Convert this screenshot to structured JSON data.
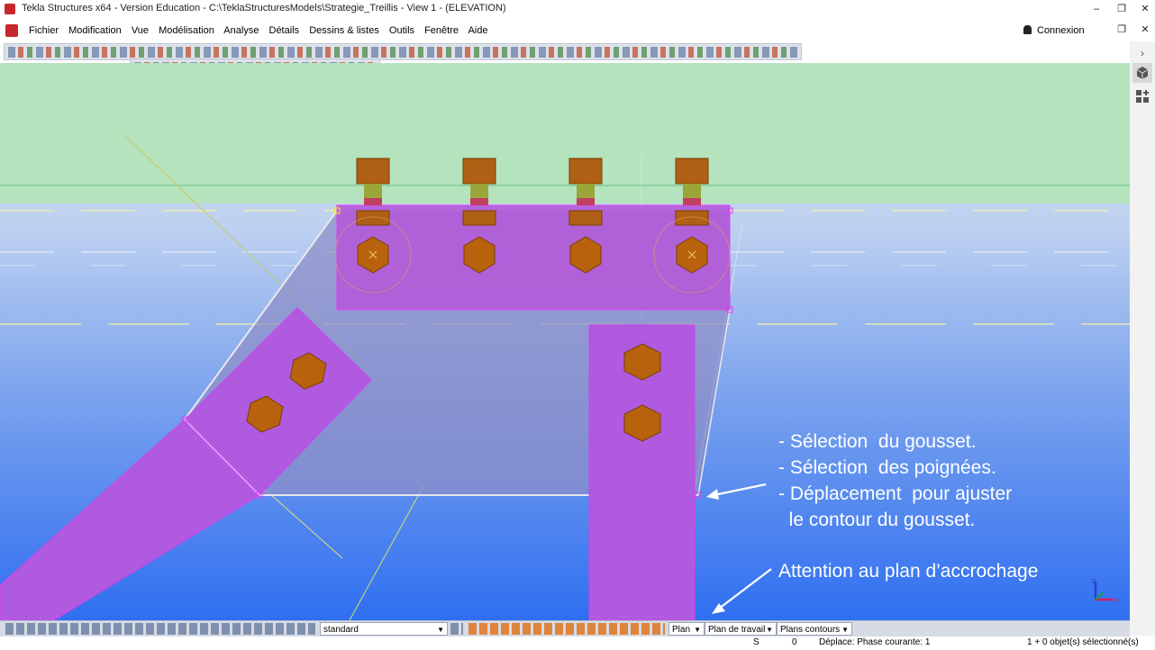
{
  "window": {
    "title": "Tekla Structures x64 - Version Education - C:\\TeklaStructuresModels\\Strategie_Treillis  - View 1 - (ELEVATION)",
    "minimize": "–",
    "maximize": "❐",
    "close": "✕"
  },
  "menu": {
    "items": [
      "Fichier",
      "Modification",
      "Vue",
      "Modélisation",
      "Analyse",
      "Détails",
      "Dessins & listes",
      "Outils",
      "Fenêtre",
      "Aide"
    ],
    "connexion": "Connexion",
    "restore": "❐",
    "close": "✕"
  },
  "sidepanel": {
    "expand": "›",
    "model_icon": "cube-icon",
    "components_icon": "components-icon"
  },
  "annotations": {
    "steps": "- Sélection  du gousset.\n- Sélection  des poignées.\n- Déplacement  pour ajuster\n  le contour du gousset.",
    "warning": "Attention au plan d’accrochage"
  },
  "statusbar": {
    "filter": "standard",
    "plane_mode": "Plan",
    "work_plane": "Plan de travail",
    "contour_planes": "Plans contours"
  },
  "bottombar": {
    "snap_key": "S",
    "count": "0",
    "message": "Déplace: Phase courante: 1",
    "selection": "1 + 0 objet(s) sélectionné(s)"
  },
  "colors": {
    "plate": "#b05ae0",
    "gusset": "#8f8fc8",
    "bolt": "#c0680a",
    "shank": "#9aa63a",
    "background_top": "#b6e4bf",
    "background_bottom": "#2f6ff0",
    "annotation": "#ffffff"
  }
}
